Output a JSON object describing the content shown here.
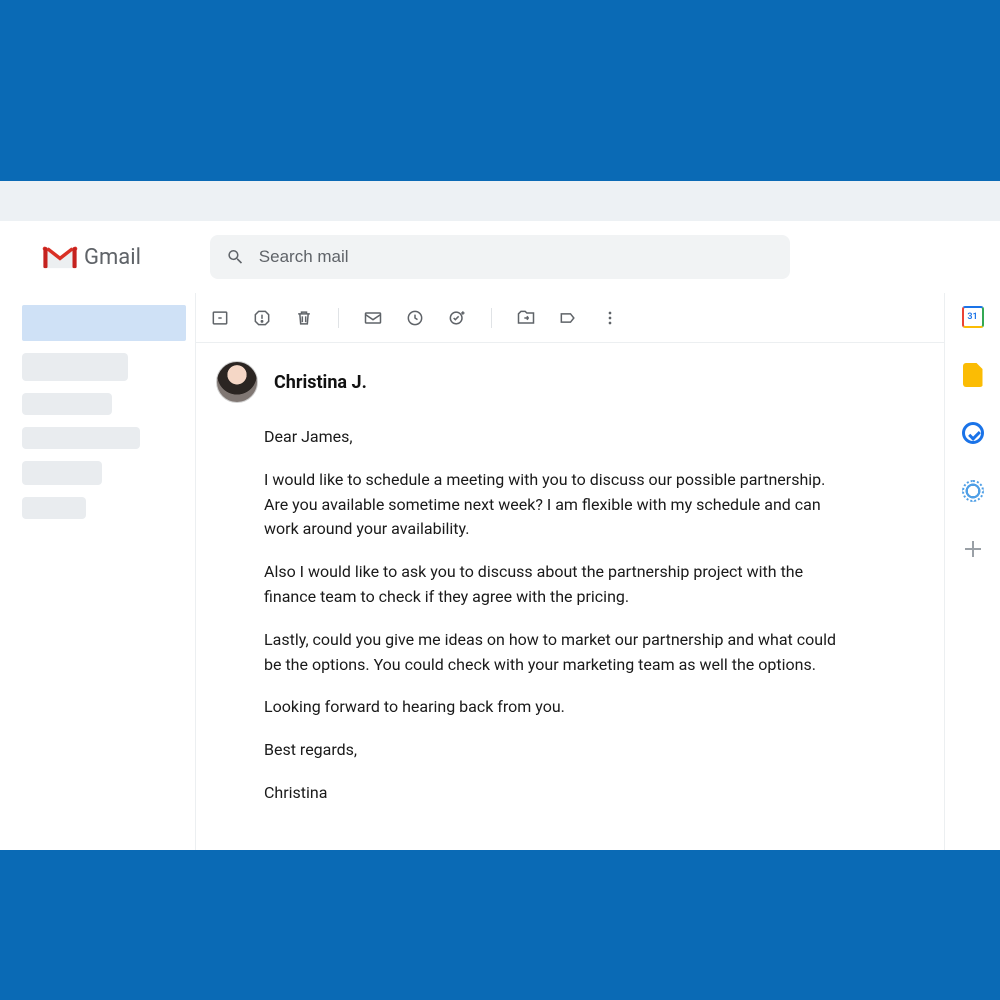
{
  "app": {
    "name": "Gmail"
  },
  "search": {
    "placeholder": "Search mail"
  },
  "rightbar": {
    "calendar_day": "31"
  },
  "email": {
    "sender": "Christina J.",
    "greeting": "Dear James,",
    "p1": "I would like to schedule a meeting with you to discuss our possible partnership. Are you available sometime next week? I am flexible with my schedule and can work around your availability.",
    "p2": "Also I would like to ask you to discuss about the partnership project with the finance team to check if they agree with the pricing.",
    "p3": "Lastly, could you give me ideas on how to market our partnership and what could be the options. You could check with your marketing team as well the options.",
    "p4": "Looking forward to hearing back from you.",
    "closing": "Best regards,",
    "signature": "Christina"
  }
}
